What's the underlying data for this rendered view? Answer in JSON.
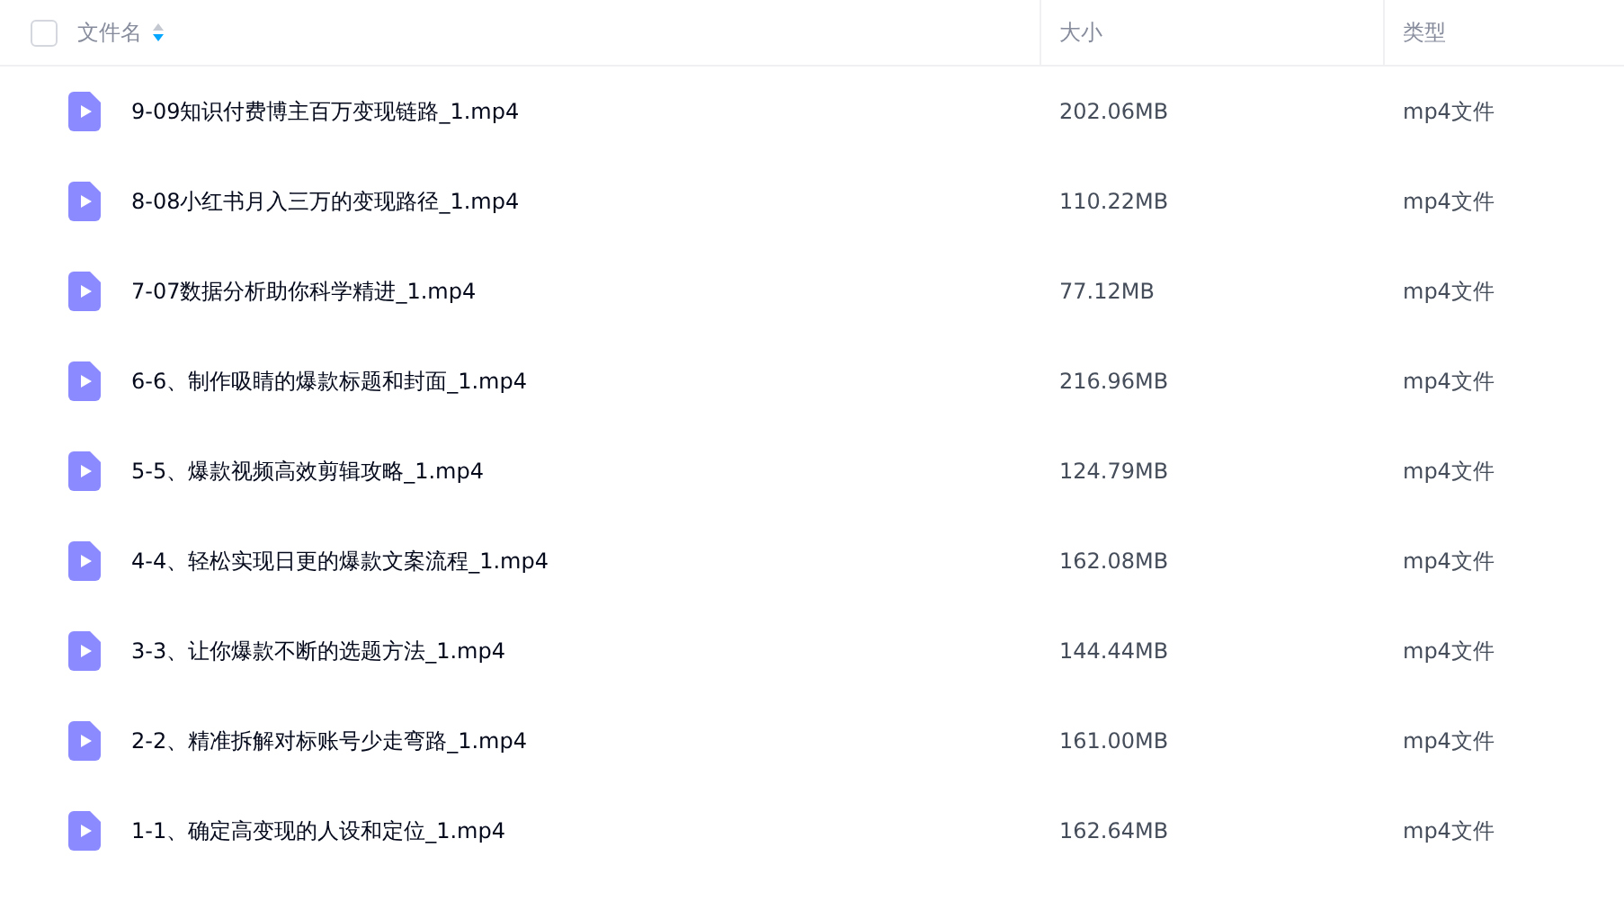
{
  "header": {
    "select_all": {
      "checked": false
    },
    "columns": [
      "文件名",
      "大小",
      "类型"
    ]
  },
  "rows": [
    {
      "name": "9-09知识付费博主百万变现链路_1.mp4",
      "size": "202.06MB",
      "type": "mp4文件"
    },
    {
      "name": "8-08小红书月入三万的变现路径_1.mp4",
      "size": "110.22MB",
      "type": "mp4文件"
    },
    {
      "name": "7-07数据分析助你科学精进_1.mp4",
      "size": "77.12MB",
      "type": "mp4文件"
    },
    {
      "name": "6-6、制作吸睛的爆款标题和封面_1.mp4",
      "size": "216.96MB",
      "type": "mp4文件"
    },
    {
      "name": "5-5、爆款视频高效剪辑攻略_1.mp4",
      "size": "124.79MB",
      "type": "mp4文件"
    },
    {
      "name": "4-4、轻松实现日更的爆款文案流程_1.mp4",
      "size": "162.08MB",
      "type": "mp4文件"
    },
    {
      "name": "3-3、让你爆款不断的选题方法_1.mp4",
      "size": "144.44MB",
      "type": "mp4文件"
    },
    {
      "name": "2-2、精准拆解对标账号少走弯路_1.mp4",
      "size": "161.00MB",
      "type": "mp4文件"
    },
    {
      "name": "1-1、确定高变现的人设和定位_1.mp4",
      "size": "162.64MB",
      "type": "mp4文件"
    }
  ]
}
